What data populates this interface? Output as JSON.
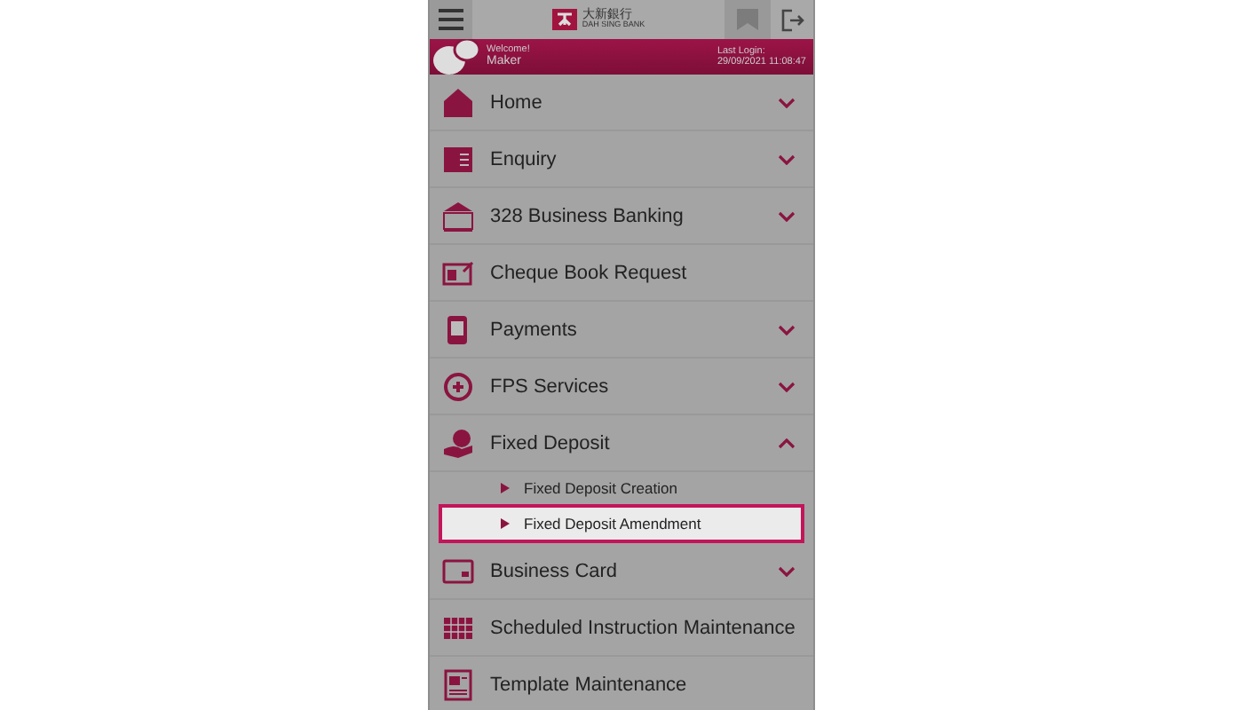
{
  "header": {
    "logo_chinese": "大新銀行",
    "logo_english": "DAH SING BANK"
  },
  "profile": {
    "welcome_label": "Welcome!",
    "user": "Maker",
    "last_login_label": "Last Login:",
    "last_login": "29/09/2021 11:08:47"
  },
  "menu": [
    {
      "label": "Home",
      "kind": "group",
      "expanded": false
    },
    {
      "label": "Enquiry",
      "kind": "group",
      "expanded": false
    },
    {
      "label": "328 Business Banking",
      "kind": "group",
      "expanded": false
    },
    {
      "label": "Cheque Book Request",
      "kind": "link"
    },
    {
      "label": "Payments",
      "kind": "group",
      "expanded": false
    },
    {
      "label": "FPS Services",
      "kind": "group",
      "expanded": false
    },
    {
      "label": "Fixed Deposit",
      "kind": "group",
      "expanded": true,
      "children": [
        {
          "label": "Fixed Deposit Creation",
          "selected": false
        },
        {
          "label": "Fixed Deposit Amendment",
          "selected": true
        }
      ]
    },
    {
      "label": "Business Card",
      "kind": "group",
      "expanded": false
    },
    {
      "label": "Scheduled Instruction Maintenance",
      "kind": "link"
    },
    {
      "label": "Template Maintenance",
      "kind": "link"
    }
  ]
}
